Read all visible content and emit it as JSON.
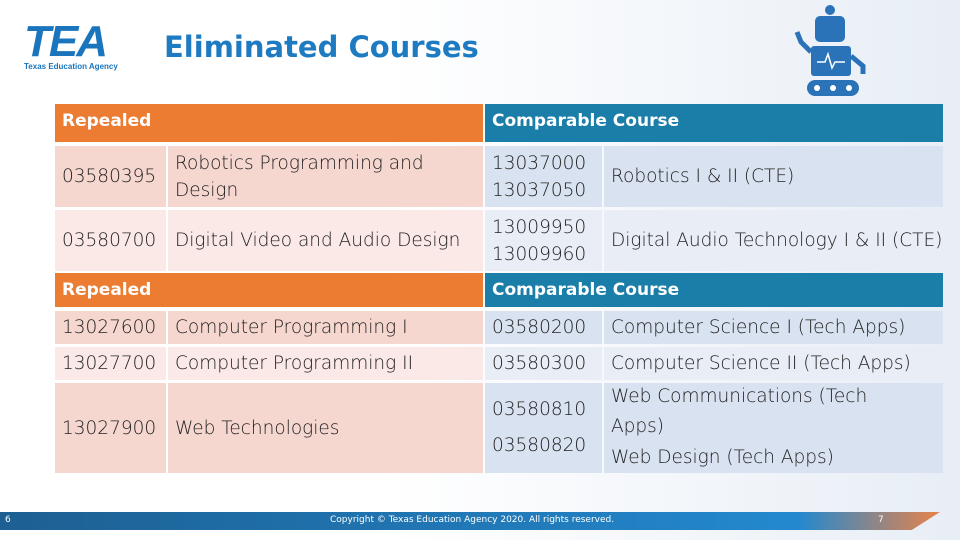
{
  "header": {
    "logo_text": "TEA",
    "logo_subtitle": "Texas Education Agency",
    "title": "Eliminated Courses",
    "robot_icon": "robot-icon"
  },
  "table": {
    "section1": {
      "left_header": "Repealed",
      "right_header": "Comparable Course",
      "rows": [
        {
          "code": "03580395",
          "name": "Robotics Programming and Design",
          "comparable_codes": [
            "13037000",
            "13037050"
          ],
          "comparable_name": "Robotics I & II (CTE)"
        },
        {
          "code": "03580700",
          "name": "Digital Video and Audio Design",
          "comparable_codes": [
            "13009950",
            "13009960"
          ],
          "comparable_name": "Digital Audio Technology I & II (CTE)"
        }
      ]
    },
    "section2": {
      "left_header": "Repealed",
      "right_header": "Comparable Course",
      "rows": [
        {
          "code": "13027600",
          "name": "Computer Programming I",
          "comparable_codes": [
            "03580200"
          ],
          "comparable_name": "Computer Science I (Tech Apps)"
        },
        {
          "code": "13027700",
          "name": "Computer Programming II",
          "comparable_codes": [
            "03580300"
          ],
          "comparable_name": "Computer Science II (Tech Apps)"
        },
        {
          "code": "13027900",
          "name": "Web Technologies",
          "comparable_codes": [
            "03580810",
            "03580820"
          ],
          "comparable_names": [
            "Web Communications (Tech Apps)",
            "Web Design (Tech Apps)"
          ]
        }
      ]
    }
  },
  "footer": {
    "left_number": "6",
    "copyright": "Copyright © Texas Education Agency 2020. All rights reserved.",
    "page_number": "7"
  }
}
